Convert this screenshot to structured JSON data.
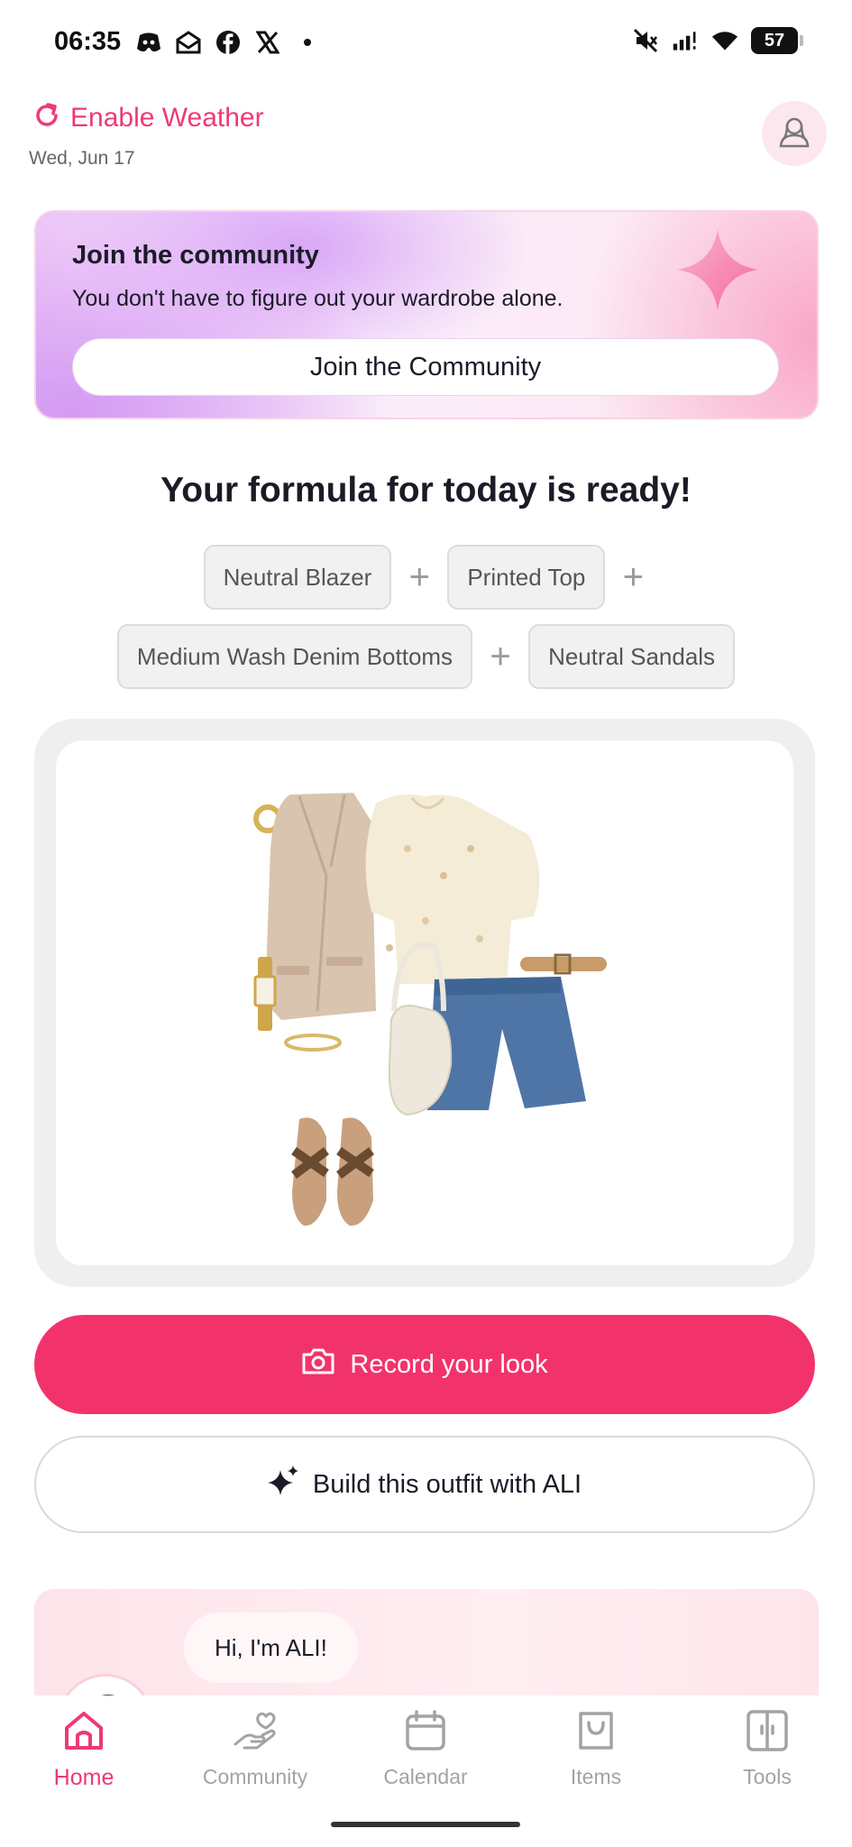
{
  "status_bar": {
    "time": "06:35",
    "battery": "57",
    "left_icons": [
      "discord-icon",
      "mail-icon",
      "facebook-icon",
      "x-icon",
      "dot-icon"
    ],
    "right_icons": [
      "mute-icon",
      "signal-icon",
      "wifi-icon",
      "battery-icon"
    ]
  },
  "header": {
    "weather_label": "Enable Weather",
    "date": "Wed, Jun 17"
  },
  "community_banner": {
    "title": "Join the community",
    "subtitle": "You don't have to figure out your wardrobe alone.",
    "button_label": "Join the Community"
  },
  "formula": {
    "title": "Your formula for today is ready!",
    "items": [
      "Neutral Blazer",
      "Printed Top",
      "Medium Wash Denim Bottoms",
      "Neutral Sandals"
    ],
    "separator": "+"
  },
  "actions": {
    "record_label": "Record your look",
    "build_label": "Build this outfit with ALI"
  },
  "ali": {
    "greeting": "Hi, I'm ALI!"
  },
  "nav": {
    "items": [
      {
        "label": "Home",
        "icon": "home-icon",
        "active": true
      },
      {
        "label": "Community",
        "icon": "hand-heart-icon",
        "active": false
      },
      {
        "label": "Calendar",
        "icon": "calendar-icon",
        "active": false
      },
      {
        "label": "Items",
        "icon": "shopping-bag-icon",
        "active": false
      },
      {
        "label": "Tools",
        "icon": "tools-icon",
        "active": false
      }
    ]
  },
  "colors": {
    "accent": "#f2336b",
    "accent_text": "#ee3a72",
    "inactive": "#a3a3a3"
  }
}
